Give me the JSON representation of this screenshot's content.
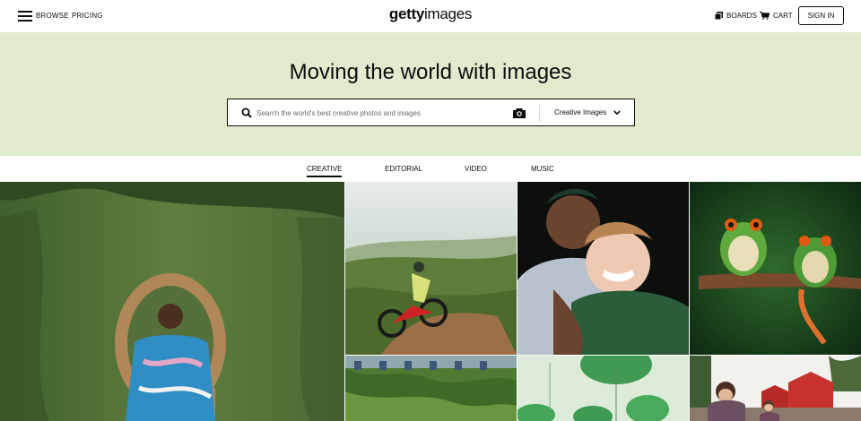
{
  "header": {
    "browse_label": "BROWSE",
    "pricing_label": "PRICING",
    "logo_bold": "getty",
    "logo_regular": "images",
    "boards_label": "BOARDS",
    "cart_label": "CART",
    "signin_label": "SIGN IN"
  },
  "hero": {
    "title": "Moving the world with images",
    "search_placeholder": "Search the world's best creative photos and images",
    "filter_label": "Creative Images",
    "background_color": "#e1eccf"
  },
  "tabs": [
    {
      "label": "CREATIVE",
      "active": true
    },
    {
      "label": "EDITORIAL",
      "active": false
    },
    {
      "label": "VIDEO",
      "active": false
    },
    {
      "label": "MUSIC",
      "active": false
    }
  ],
  "gallery": {
    "tiles": [
      {
        "subject": "woman-in-wicker-chair-photo"
      },
      {
        "subject": "mountain-biker-photo"
      },
      {
        "subject": "smiling-couple-photo"
      },
      {
        "subject": "tree-frogs-photo"
      },
      {
        "subject": "ivy-covered-building-photo"
      },
      {
        "subject": "green-umbrellas-photo"
      },
      {
        "subject": "red-barn-farm-photo"
      }
    ]
  }
}
